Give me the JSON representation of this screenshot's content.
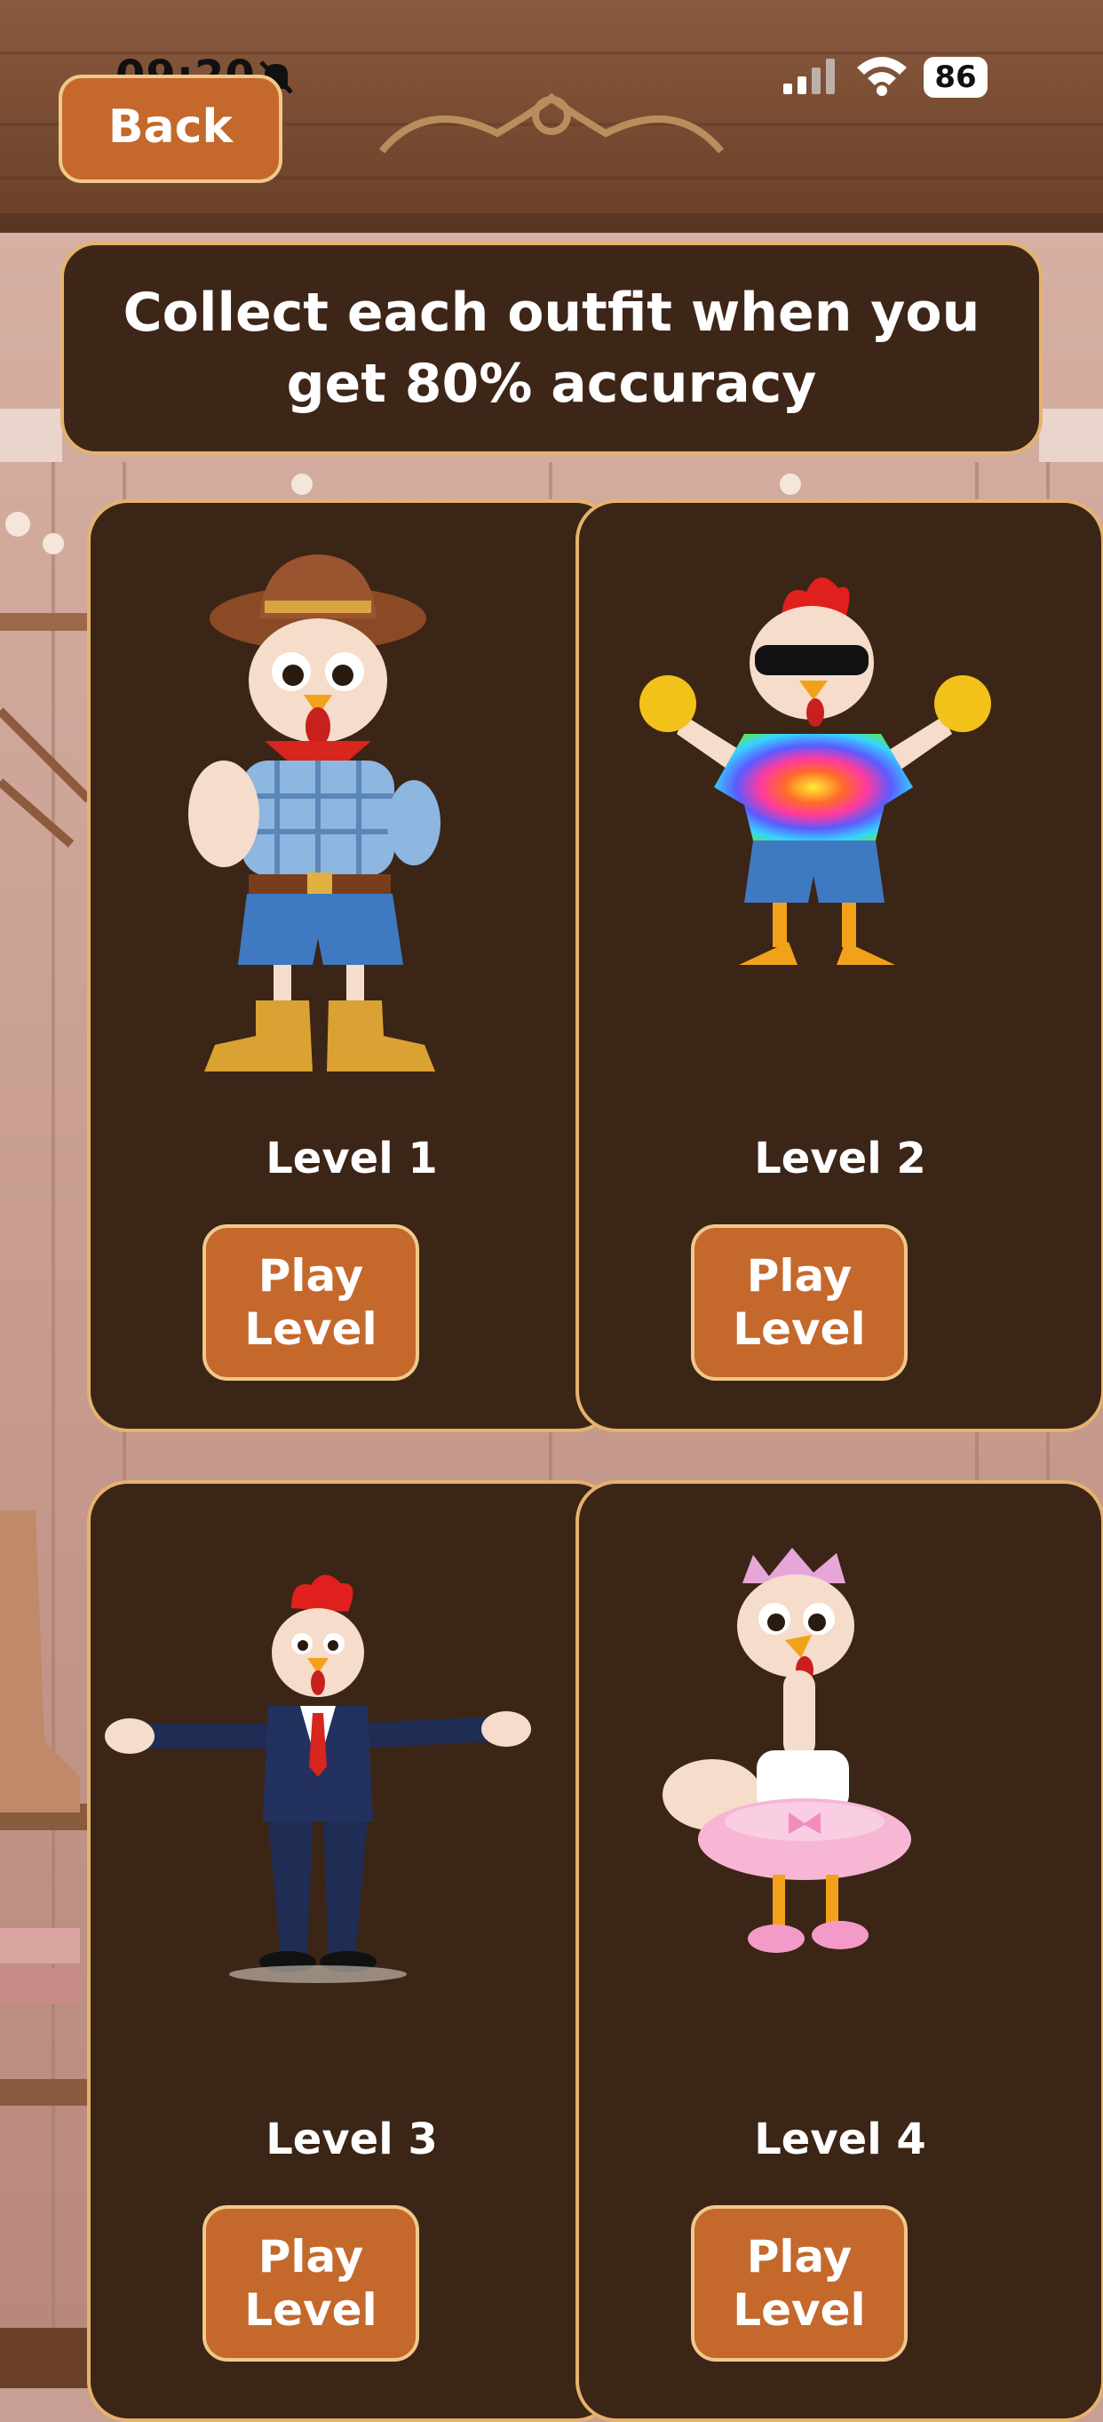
{
  "status_bar": {
    "time": "09:20",
    "battery": "86"
  },
  "back_button": {
    "label": "Back"
  },
  "banner": {
    "text": "Collect each outfit when you get 80% accuracy"
  },
  "levels": [
    {
      "label": "Level 1",
      "button": "Play\nLevel",
      "outfit": "cowboy-chicken"
    },
    {
      "label": "Level 2",
      "button": "Play\nLevel",
      "outfit": "tie-dye-chicken"
    },
    {
      "label": "Level 3",
      "button": "Play\nLevel",
      "outfit": "suit-chicken"
    },
    {
      "label": "Level 4",
      "button": "Play\nLevel",
      "outfit": "tutu-chicken"
    }
  ],
  "colors": {
    "card_bg": "#3b2516",
    "card_border": "#e6b26e",
    "button_bg": "#c4682c",
    "button_border": "#f0c98a",
    "text": "#ffffff"
  }
}
